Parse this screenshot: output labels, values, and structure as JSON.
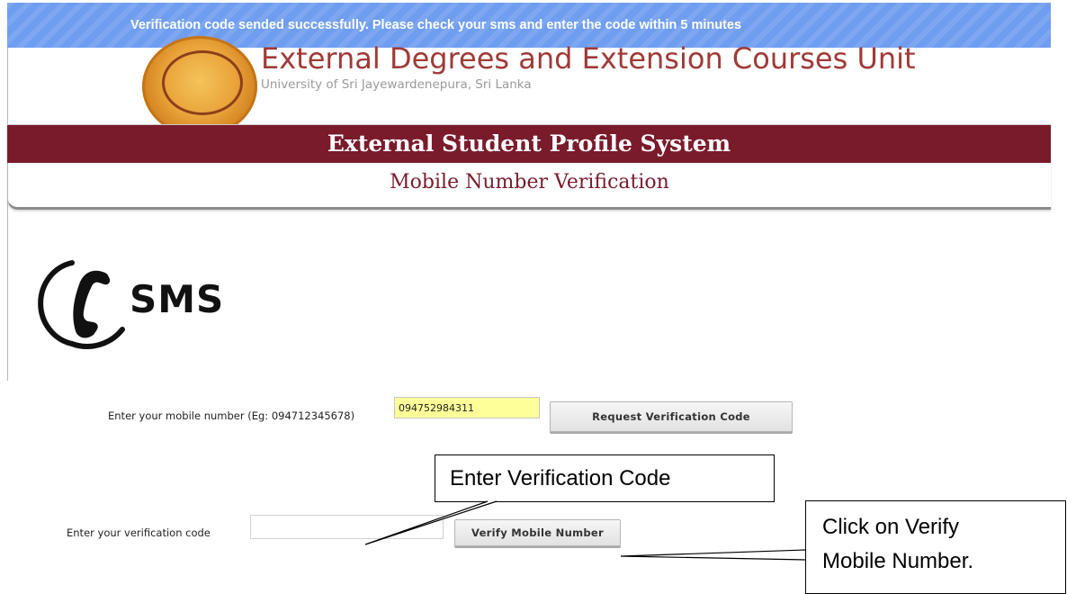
{
  "notification": {
    "message": "Verification code sended successfully. Please check your sms and enter the code within 5 minutes"
  },
  "header": {
    "unit_title": "External Degrees and Extension Courses Unit",
    "university": "University of Sri Jayewardenepura, Sri Lanka",
    "system_title": "External Student Profile System",
    "page_title": "Mobile Number Verification"
  },
  "sms_icon": {
    "label": "SMS",
    "icon": "phone-handset-icon"
  },
  "form": {
    "mobile_label": "Enter your mobile number (Eg: 094712345678)",
    "mobile_value": "094752984311",
    "request_button": "Request Verification Code",
    "code_label": "Enter your verification code",
    "code_value": "",
    "verify_button": "Verify Mobile Number"
  },
  "annotations": {
    "enter_code": "Enter Verification Code",
    "click_verify_line1": "Click on Verify",
    "click_verify_line2": "Mobile Number."
  },
  "colors": {
    "banner": "#6f9df0",
    "maroon": "#7a1b2c",
    "input_highlight": "#ffff99"
  }
}
